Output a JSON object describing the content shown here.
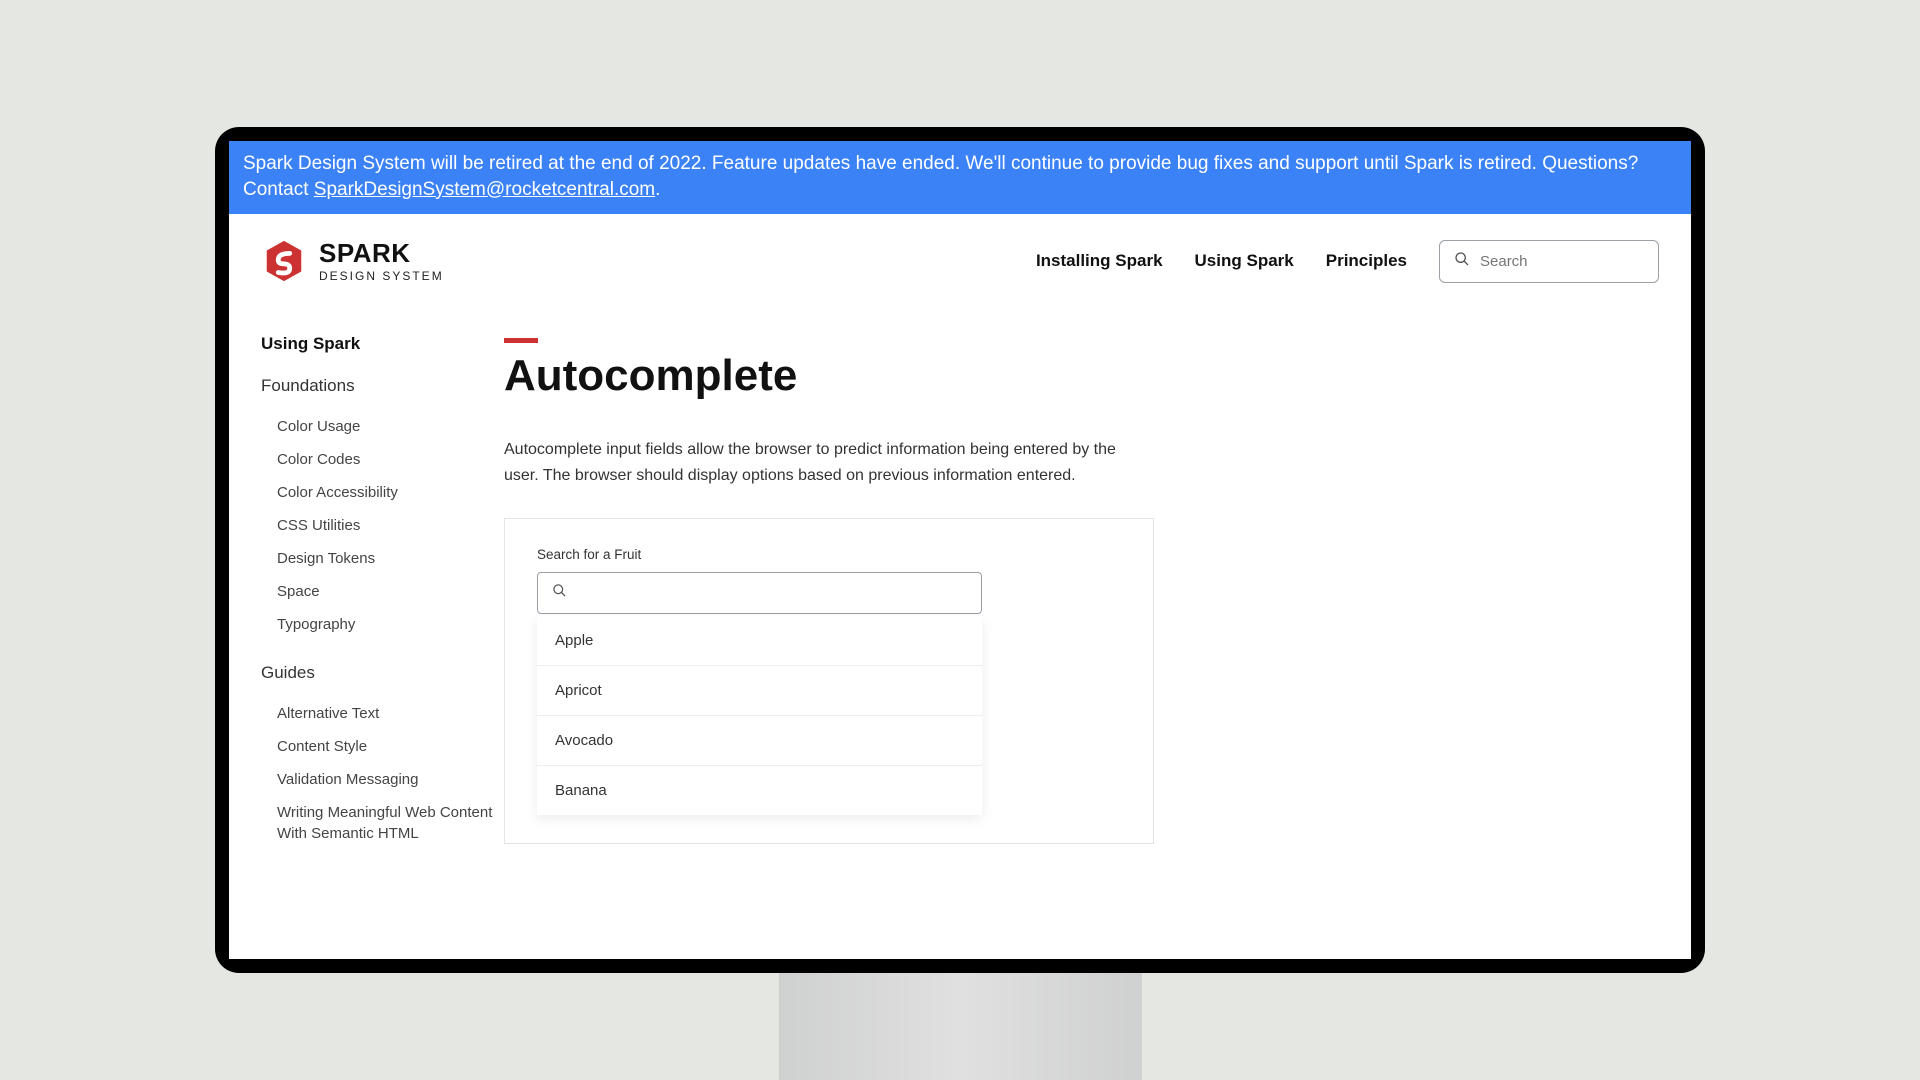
{
  "banner": {
    "text_before": "Spark Design System will be retired at the end of 2022. Feature updates have ended. We'll continue to provide bug fixes and support until Spark is retired. Questions? Contact ",
    "email": "SparkDesignSystem@rocketcentral.com",
    "text_after": "."
  },
  "logo": {
    "brand": "SPARK",
    "sub": "DESIGN SYSTEM"
  },
  "nav": {
    "items": [
      "Installing Spark",
      "Using Spark",
      "Principles"
    ]
  },
  "search": {
    "placeholder": "Search"
  },
  "sidebar": {
    "heading": "Using Spark",
    "sections": [
      {
        "title": "Foundations",
        "items": [
          "Color Usage",
          "Color Codes",
          "Color Accessibility",
          "CSS Utilities",
          "Design Tokens",
          "Space",
          "Typography"
        ]
      },
      {
        "title": "Guides",
        "items": [
          "Alternative Text",
          "Content Style",
          "Validation Messaging",
          "Writing Meaningful Web Content With Semantic HTML"
        ]
      }
    ]
  },
  "page": {
    "title": "Autocomplete",
    "description": "Autocomplete input fields allow the browser to predict information being entered by the user. The browser should display options based on previous information entered."
  },
  "demo": {
    "label": "Search for a Fruit",
    "options": [
      "Apple",
      "Apricot",
      "Avocado",
      "Banana"
    ]
  }
}
